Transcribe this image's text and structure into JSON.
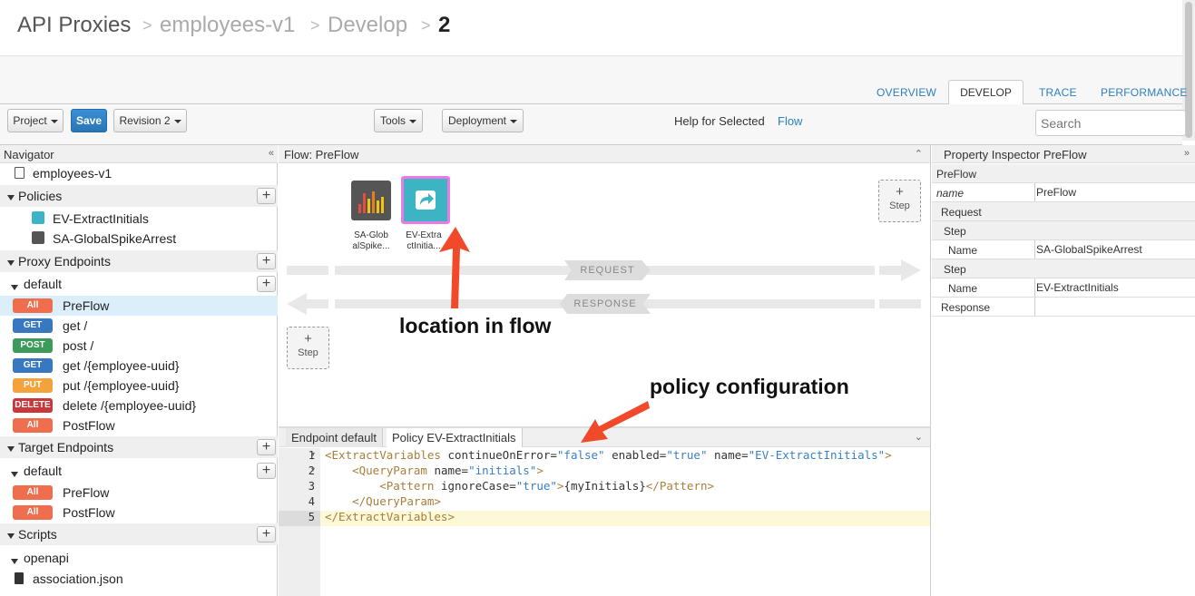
{
  "breadcrumb": [
    "API Proxies",
    "employees-v1",
    "Develop",
    "2"
  ],
  "tabs": [
    "OVERVIEW",
    "DEVELOP",
    "TRACE",
    "PERFORMANCE"
  ],
  "toolbar": {
    "project": "Project",
    "save": "Save",
    "revision": "Revision 2",
    "tools": "Tools",
    "deployment": "Deployment",
    "help_text": "Help for Selected",
    "help_link": "Flow",
    "search_placeholder": "Search"
  },
  "navigator": {
    "title": "Navigator",
    "proxy_name": "employees-v1",
    "policies_label": "Policies",
    "policies": [
      "EV-ExtractInitials",
      "SA-GlobalSpikeArrest"
    ],
    "proxy_endpoints_label": "Proxy Endpoints",
    "proxy_default": "default",
    "proxy_flows": [
      {
        "badge": "All",
        "label": "PreFlow"
      },
      {
        "badge": "GET",
        "label": "get /"
      },
      {
        "badge": "POST",
        "label": "post /"
      },
      {
        "badge": "GET",
        "label": "get /{employee-uuid}"
      },
      {
        "badge": "PUT",
        "label": "put /{employee-uuid}"
      },
      {
        "badge": "DELETE",
        "label": "delete /{employee-uuid}"
      },
      {
        "badge": "All",
        "label": "PostFlow"
      }
    ],
    "target_endpoints_label": "Target Endpoints",
    "target_default": "default",
    "target_flows": [
      {
        "badge": "All",
        "label": "PreFlow"
      },
      {
        "badge": "All",
        "label": "PostFlow"
      }
    ],
    "scripts_label": "Scripts",
    "scripts_folder": "openapi",
    "scripts_file": "association.json"
  },
  "flow": {
    "title": "Flow: PreFlow",
    "policy1_label_a": "SA-Glob",
    "policy1_label_b": "alSpike...",
    "policy2_label_a": "EV-Extra",
    "policy2_label_b": "ctInitia...",
    "step_plus": "+",
    "step_label": "Step",
    "request": "REQUEST",
    "response": "RESPONSE"
  },
  "editor": {
    "tab1": "Endpoint default",
    "tab2": "Policy EV-ExtractInitials",
    "lines": [
      "1",
      "2",
      "3",
      "4",
      "5"
    ]
  },
  "inspector": {
    "title": "Property Inspector  PreFlow",
    "preflow": "PreFlow",
    "name_key": "name",
    "name_val": "PreFlow",
    "request": "Request",
    "step1": "Step",
    "name1_key": "Name",
    "name1_val": "SA-GlobalSpikeArrest",
    "step2": "Step",
    "name2_key": "Name",
    "name2_val": "EV-ExtractInitials",
    "response": "Response"
  },
  "annotations": {
    "location": "location in flow",
    "policy_config": "policy configuration"
  },
  "colors": {
    "accent": "#2e7fbd",
    "arrow": "#f04a2a",
    "selected_policy_border": "#e97ae6"
  }
}
